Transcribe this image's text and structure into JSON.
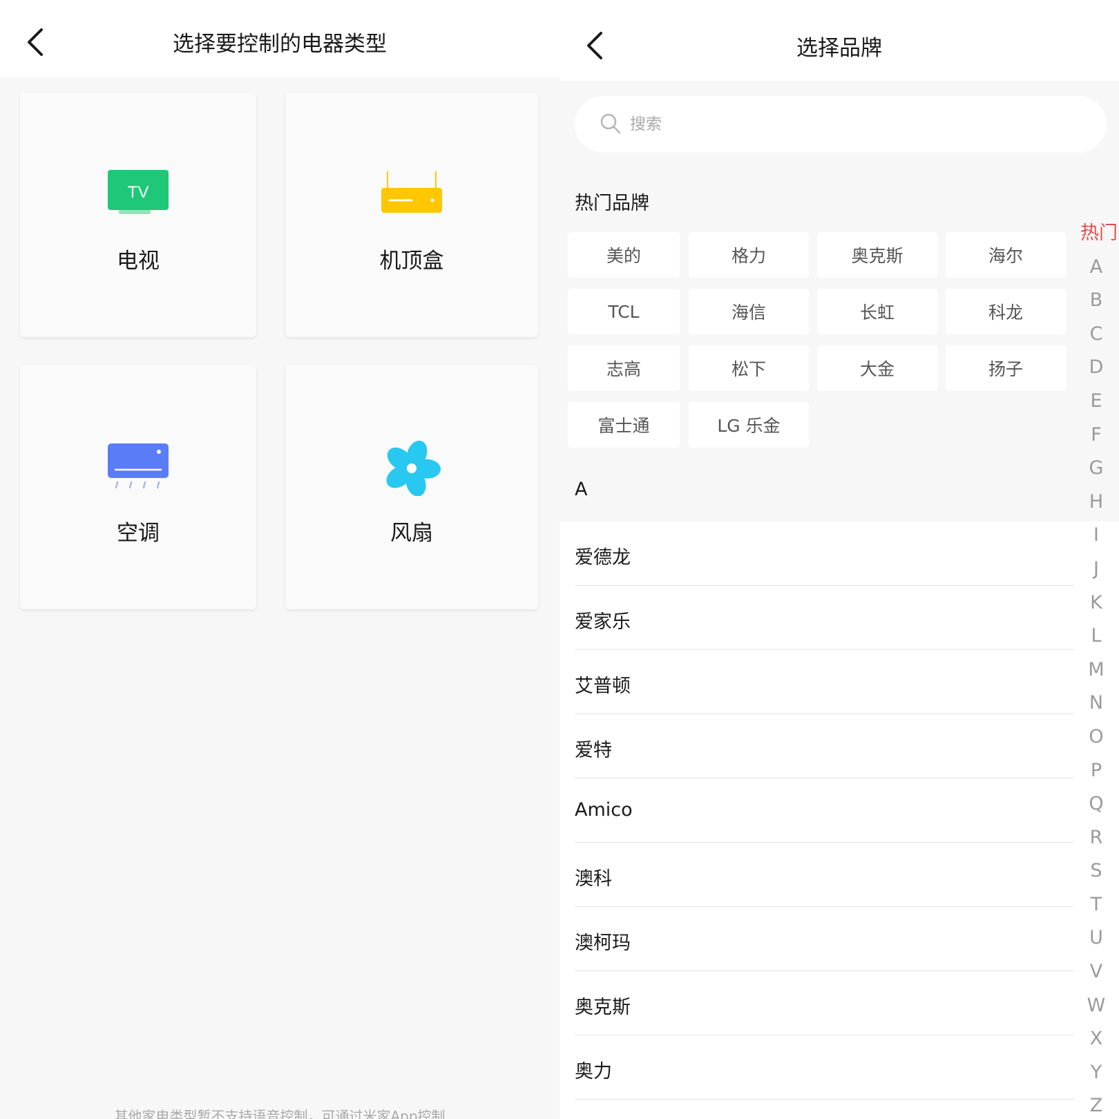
{
  "left": {
    "title": "选择要控制的电器类型",
    "devices": [
      {
        "label": "电视",
        "icon": "tv-icon",
        "icon_text": "TV",
        "color": "#1ec878"
      },
      {
        "label": "机顶盒",
        "icon": "set-top-box-icon",
        "color": "#ffc700"
      },
      {
        "label": "空调",
        "icon": "air-conditioner-icon",
        "color": "#5b7cf7"
      },
      {
        "label": "风扇",
        "icon": "fan-icon",
        "color": "#28c8f0"
      }
    ],
    "footer": "其他家电类型暂不支持语音控制，可通过米家App控制"
  },
  "right": {
    "title": "选择品牌",
    "search_placeholder": "搜索",
    "hot_title": "热门品牌",
    "hot_brands": [
      "美的",
      "格力",
      "奥克斯",
      "海尔",
      "TCL",
      "海信",
      "长虹",
      "科龙",
      "志高",
      "松下",
      "大金",
      "扬子",
      "富士通",
      "LG 乐金"
    ],
    "section_letter": "A",
    "brands": [
      "爱德龙",
      "爱家乐",
      "艾普顿",
      "爱特",
      "Amico",
      "澳科",
      "澳柯玛",
      "奥克斯",
      "奥力"
    ],
    "index": [
      "热门",
      "A",
      "B",
      "C",
      "D",
      "E",
      "F",
      "G",
      "H",
      "I",
      "J",
      "K",
      "L",
      "M",
      "N",
      "O",
      "P",
      "Q",
      "R",
      "S",
      "T",
      "U",
      "V",
      "W",
      "X",
      "Y",
      "Z"
    ],
    "index_active_color": "#e94b4b"
  }
}
